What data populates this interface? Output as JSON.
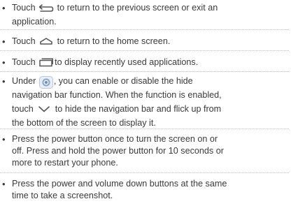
{
  "items": [
    {
      "id": "back",
      "icon": "back-arrow-icon",
      "pre": "Touch ",
      "post": " to return to the previous screen or exit an",
      "line2": "application."
    },
    {
      "id": "home",
      "icon": "home-icon",
      "pre": "Touch ",
      "post": " to return to the home screen."
    },
    {
      "id": "recent",
      "icon": "recent-apps-icon",
      "pre": "Touch ",
      "post": "to display recently used applications."
    },
    {
      "id": "navbar",
      "icon": "settings-gear-icon",
      "icon2": "chevron-down-icon",
      "pre": "Under ",
      "post": ", you can enable or disable the hide",
      "line2": "navigation bar function. When the function is enabled,",
      "line3_pre": "touch ",
      "line3_post": " to hide the navigation bar and flick up from",
      "line4": "the bottom of the screen to display it."
    },
    {
      "id": "power",
      "line1": "Press the power button once to turn the screen on or",
      "line2": "off. Press and hold the power button for 10 seconds or",
      "line3": "more to restart your phone."
    },
    {
      "id": "screenshot",
      "line1": "Press the power and volume down buttons at the same",
      "line2": "time to take a screenshot."
    }
  ],
  "colors": {
    "text": "#3a3a3a",
    "icon": "#555555",
    "gear_outer": "#6fa8dc",
    "separator": "#bdbdbd"
  }
}
